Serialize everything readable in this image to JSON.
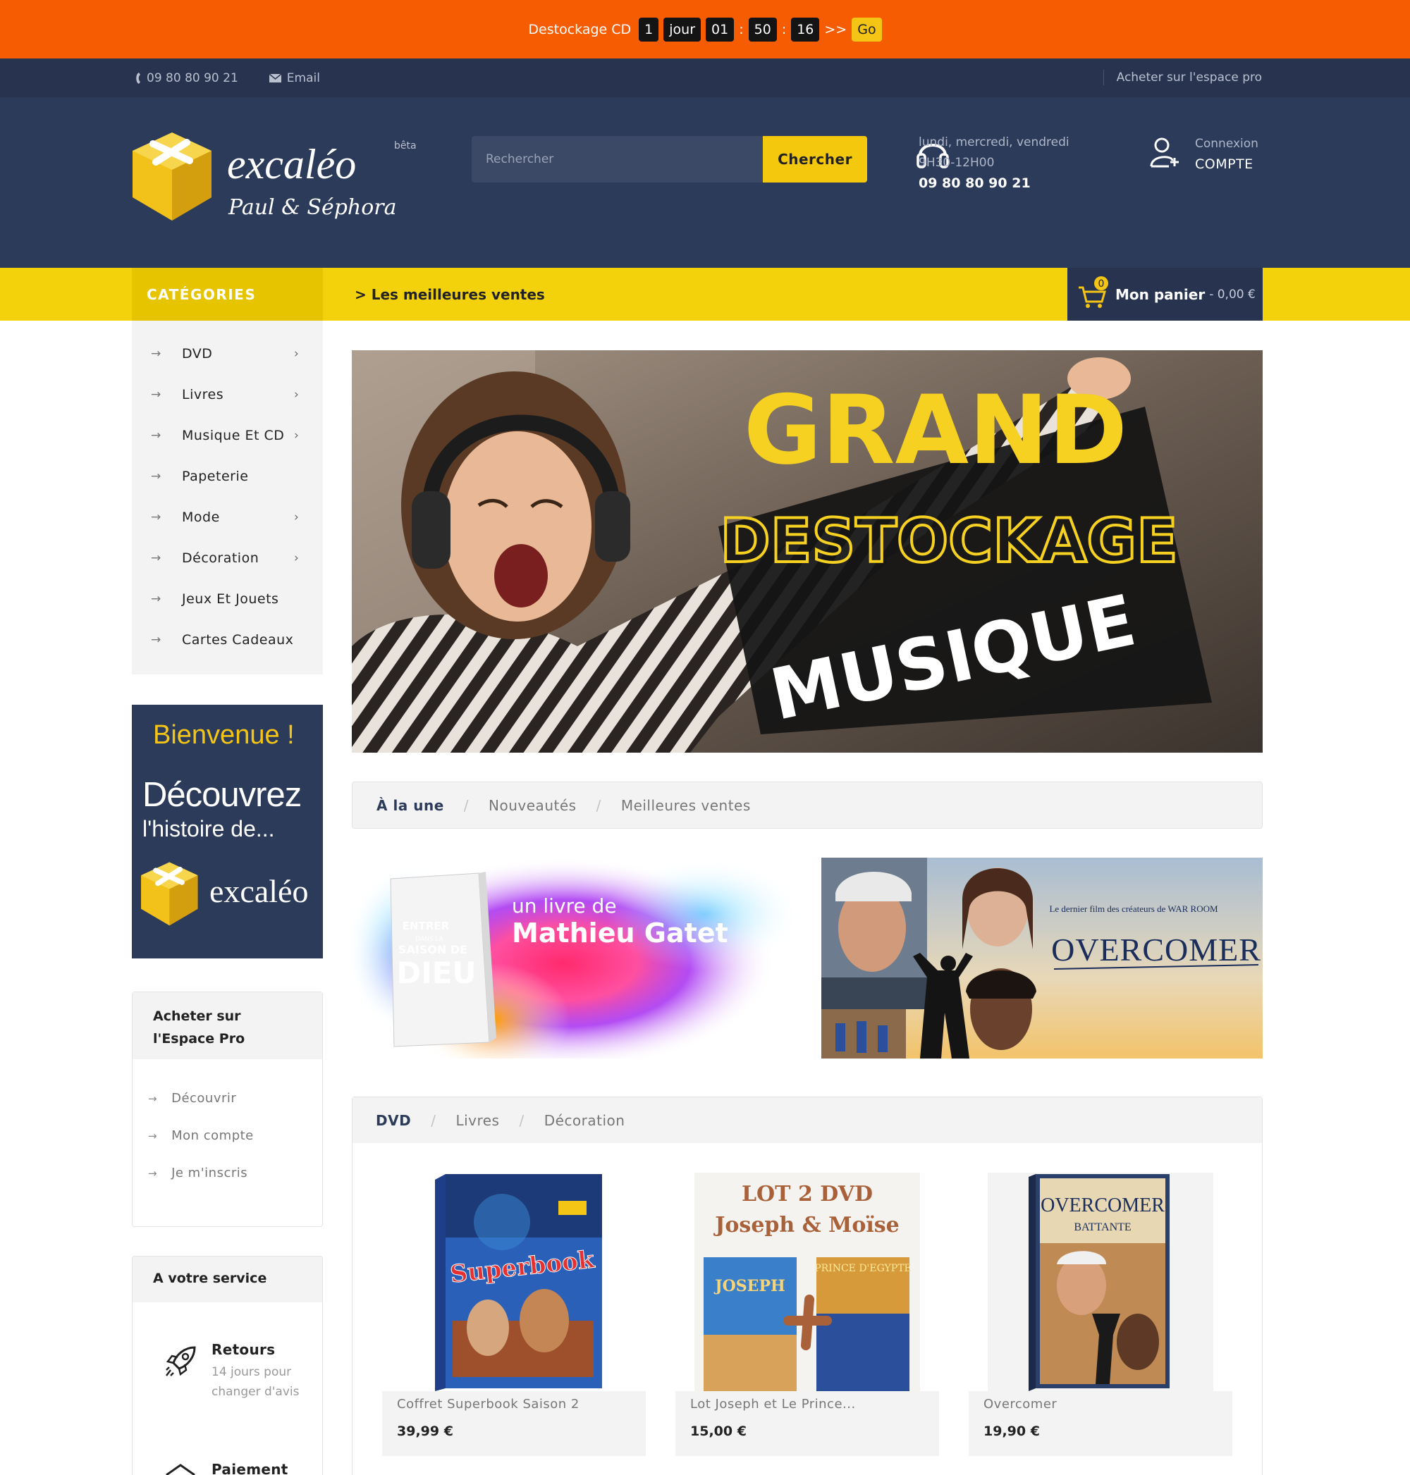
{
  "promo": {
    "label": "Destockage CD",
    "days": "1",
    "days_unit": "jour",
    "hours": "01",
    "minutes": "50",
    "seconds": "16",
    "arrows": ">>",
    "go": "Go"
  },
  "topbar": {
    "phone": "09 80 80 90 21",
    "email": "Email",
    "pro_link": "Acheter sur l'espace pro"
  },
  "logo": {
    "brand": "excaléo",
    "sub": "Paul & Séphora",
    "badge": "bêta"
  },
  "search": {
    "placeholder": "Rechercher",
    "button": "Chercher"
  },
  "support": {
    "days": "lundi, mercredi, vendredi",
    "hours": "9H30-12H00",
    "phone": "09 80 80 90 21"
  },
  "account": {
    "login": "Connexion",
    "label": "COMPTE"
  },
  "nav": {
    "categories": "CATÉGORIES",
    "best": "> Les meilleures ventes",
    "cart_label": "Mon panier",
    "cart_amount": "- 0,00 €",
    "cart_count": "0"
  },
  "sidebar": {
    "items": [
      {
        "label": "DVD",
        "sub": true
      },
      {
        "label": "Livres",
        "sub": true
      },
      {
        "label": "Musique Et CD",
        "sub": true
      },
      {
        "label": "Papeterie",
        "sub": false
      },
      {
        "label": "Mode",
        "sub": true
      },
      {
        "label": "Décoration",
        "sub": true
      },
      {
        "label": "Jeux Et Jouets",
        "sub": false
      },
      {
        "label": "Cartes Cadeaux",
        "sub": false
      }
    ]
  },
  "welcome": {
    "title": "Bienvenue !",
    "line1": "Découvrez",
    "line2": "l'histoire de...",
    "brand": "excaléo"
  },
  "pro": {
    "title_1": "Acheter sur",
    "title_2": "l'Espace Pro",
    "links": [
      "Découvrir",
      "Mon compte",
      "Je m'inscris"
    ]
  },
  "service": {
    "title": "A votre service",
    "items": [
      {
        "title": "Retours",
        "desc": "14 jours pour changer d'avis"
      },
      {
        "title": "Paiement",
        "desc": ""
      }
    ]
  },
  "hero": {
    "line1": "GRAND",
    "line2": "DESTOCKAGE",
    "line3": "MUSIQUE"
  },
  "tabs1": [
    "À la une",
    "Nouveautés",
    "Meilleures ventes"
  ],
  "banner1": {
    "small": "un livre de",
    "big": "Mathieu Gatet",
    "book_1": "ENTRER",
    "book_2": "DANS LA",
    "book_3": "SAISON DE",
    "book_4": "DIEU"
  },
  "banner2": {
    "tag": "Le dernier film des créateurs de WAR ROOM",
    "title": "OVERCOMER"
  },
  "tabs2": [
    "DVD",
    "Livres",
    "Décoration"
  ],
  "products": [
    {
      "name": "Coffret Superbook Saison 2",
      "price": "39,99 €",
      "cover": "Superbook"
    },
    {
      "name": "Lot Joseph et Le Prince...",
      "price": "15,00 €",
      "cover_1": "LOT 2 DVD",
      "cover_2": "Joseph & Moïse",
      "cover_3": "JOSEPH",
      "cover_4": "PRINCE D'EGYPTE"
    },
    {
      "name": "Overcomer",
      "price": "19,90 €",
      "cover_1": "OVERCOMER",
      "cover_2": "BATTANTE"
    }
  ]
}
